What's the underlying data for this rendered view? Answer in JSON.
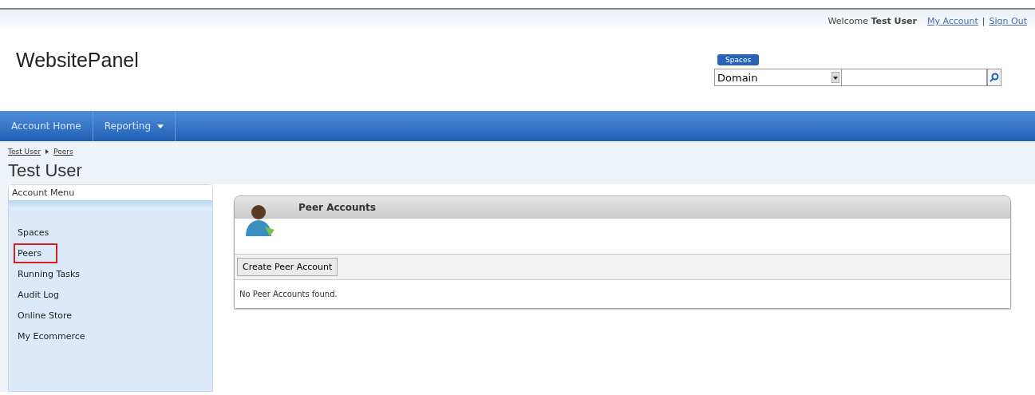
{
  "header": {
    "welcome": "Welcome",
    "user": "Test User",
    "links": [
      {
        "label": "My Account"
      },
      {
        "label": "Sign Out"
      }
    ],
    "separator": "|",
    "logo": "WebsitePanel"
  },
  "search": {
    "tag": "Spaces",
    "dropdown": "Domain"
  },
  "nav": [
    {
      "label": "Account Home",
      "has_menu": false
    },
    {
      "label": "Reporting",
      "has_menu": true
    }
  ],
  "breadcrumb": [
    {
      "label": "Test User"
    },
    {
      "label": "Peers"
    }
  ],
  "page_title": "Test User",
  "sidebar": {
    "title": "Account Menu",
    "items": [
      {
        "label": "Spaces",
        "selected": false
      },
      {
        "label": "Peers",
        "selected": true
      },
      {
        "label": "Running Tasks",
        "selected": false
      },
      {
        "label": "Audit Log",
        "selected": false
      },
      {
        "label": "Online Store",
        "selected": false
      },
      {
        "label": "My Ecommerce",
        "selected": false
      }
    ]
  },
  "panel": {
    "title": "Peer Accounts",
    "button": "Create Peer Account",
    "empty_message": "No Peer Accounts found."
  }
}
